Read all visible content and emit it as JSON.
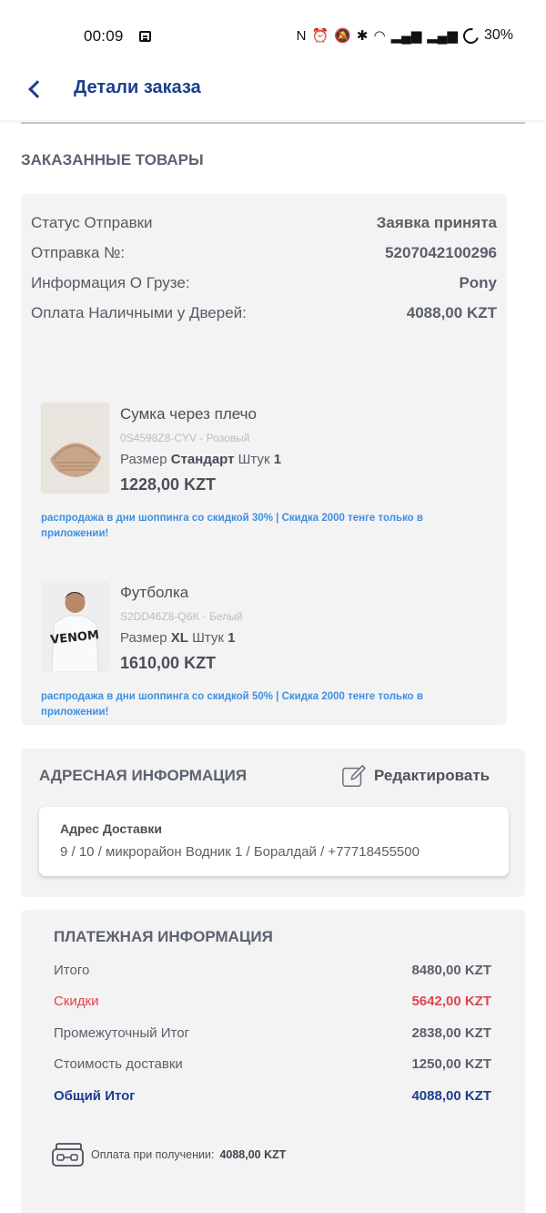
{
  "status_bar": {
    "time": "00:09",
    "battery": "30%"
  },
  "header": {
    "title": "Детали заказа"
  },
  "ordered_goods": {
    "section_title": "ЗАКАЗАННЫЕ ТОВАРЫ",
    "details": [
      {
        "label": "Статус Отправки",
        "value": "Заявка принята"
      },
      {
        "label": "Отправка №:",
        "value": "5207042100296"
      },
      {
        "label": "Информация О Грузе:",
        "value": "Pony"
      },
      {
        "label": "Оплата Наличными у Дверей:",
        "value": "4088,00 KZT"
      }
    ],
    "items": [
      {
        "name": "Сумка через плечо",
        "sku": "0S4598Z8-CYV - Розовый",
        "size_label": "Размер",
        "size": "Стандарт",
        "qty_label": "Штук",
        "qty": "1",
        "price": "1228,00 KZT",
        "promo": "распродажа в дни шоппинга со скидкой 30% | Скидка 2000 тенге только в приложении!"
      },
      {
        "name": "Футболка",
        "sku": "S2DD46Z8-Q6K - Белый",
        "size_label": "Размер",
        "size": "XL",
        "qty_label": "Штук",
        "qty": "1",
        "price": "1610,00 KZT",
        "promo": "распродажа в дни шоппинга со скидкой 50% | Скидка 2000 тенге только в приложении!",
        "shirt_print": "VENOM"
      }
    ]
  },
  "address": {
    "section_title": "АДРЕСНАЯ ИНФОРМАЦИЯ",
    "edit_label": "Редактировать",
    "delivery_label": "Адрес Доставки",
    "delivery_value": "9 / 10 / микрорайон Водник 1 / Боралдай / +77718455500"
  },
  "payment": {
    "section_title": "ПЛАТЕЖНАЯ ИНФОРМАЦИЯ",
    "rows": [
      {
        "label": "Итого",
        "value": "8480,00 KZT"
      },
      {
        "label": "Скидки",
        "value": "5642,00 KZT"
      },
      {
        "label": "Промежуточный Итог",
        "value": "2838,00 KZT"
      },
      {
        "label": "Стоимость доставки",
        "value": "1250,00 KZT"
      },
      {
        "label": "Общий Итог",
        "value": "4088,00 KZT"
      }
    ],
    "cod_label": "Оплата при получении:",
    "cod_value": "4088,00 KZT"
  },
  "colors": {
    "brand_blue": "#1b3e8f",
    "discount_red": "#e0454f",
    "promo_blue": "#3f8fe0",
    "card_bg": "#f3f3f4"
  }
}
